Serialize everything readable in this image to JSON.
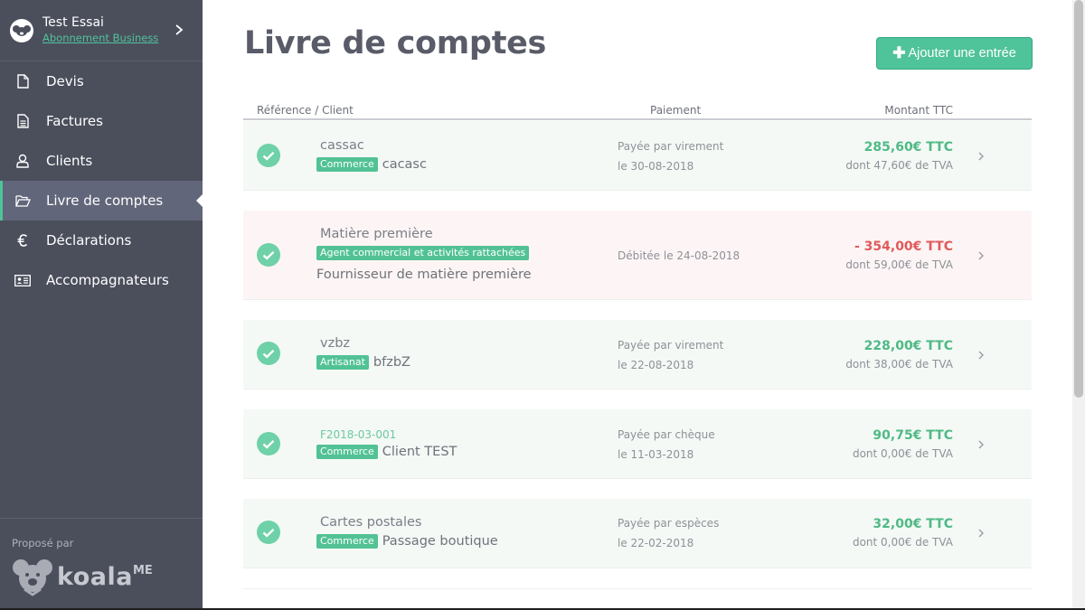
{
  "account": {
    "name": "Test Essai",
    "plan": "Abonnement Business"
  },
  "nav": {
    "items": [
      {
        "label": "Devis",
        "icon": "document-icon"
      },
      {
        "label": "Factures",
        "icon": "invoice-icon"
      },
      {
        "label": "Clients",
        "icon": "user-icon"
      },
      {
        "label": "Livre de comptes",
        "icon": "folder-open-icon",
        "active": true
      },
      {
        "label": "Déclarations",
        "icon": "euro-icon"
      },
      {
        "label": "Accompagnateurs",
        "icon": "id-card-icon"
      }
    ]
  },
  "footer": {
    "proposed": "Proposé par",
    "brand": "koala",
    "brand_suffix": "ME"
  },
  "page": {
    "title": "Livre de comptes",
    "add_button": "Ajouter une entrée"
  },
  "table": {
    "headers": {
      "reference": "Référence / Client",
      "payment": "Paiement",
      "amount": "Montant TTC"
    },
    "rows": [
      {
        "ref": "cassac",
        "tag": "Commerce",
        "client": "cacasc",
        "payment_line1": "Payée par virement",
        "payment_line2": "le 30-08-2018",
        "amount": "285,60€ TTC",
        "vat": "dont 47,60€ de TVA",
        "status": "paid"
      },
      {
        "ref": "Matière première",
        "tag": "Agent commercial et activités rattachées",
        "client": "Fournisseur de matière première",
        "payment_line1": "Débitée le 24-08-2018",
        "amount": "- 354,00€ TTC",
        "vat": "dont 59,00€ de TVA",
        "status": "debit"
      },
      {
        "ref": "vzbz",
        "tag": "Artisanat",
        "client": "bfzbZ",
        "payment_line1": "Payée par virement",
        "payment_line2": "le 22-08-2018",
        "amount": "228,00€ TTC",
        "vat": "dont 38,00€ de TVA",
        "status": "paid"
      },
      {
        "ref": "F2018-03-001",
        "tag": "Commerce",
        "client": "Client TEST",
        "payment_line1": "Payée par chèque",
        "payment_line2": "le 11-03-2018",
        "amount": "90,75€ TTC",
        "vat": "dont 0,00€ de TVA",
        "status": "paid"
      },
      {
        "ref": "Cartes postales",
        "tag": "Commerce",
        "client": "Passage boutique",
        "payment_line1": "Payée par espèces",
        "payment_line2": "le 22-02-2018",
        "amount": "32,00€ TTC",
        "vat": "dont 0,00€ de TVA",
        "status": "paid"
      }
    ]
  },
  "colors": {
    "sidebar": "#4b4f5c",
    "accent": "#4fc39a",
    "positive": "#4fb985",
    "negative": "#e05a5a"
  }
}
